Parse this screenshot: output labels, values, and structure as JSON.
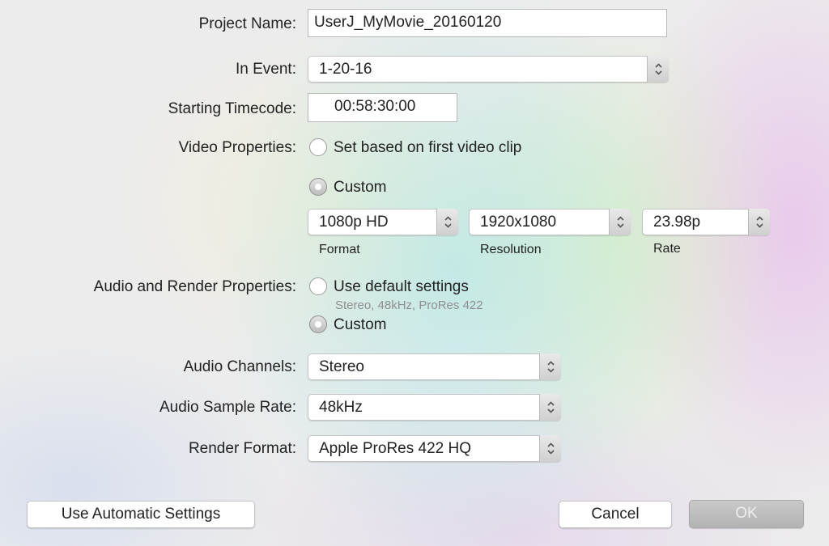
{
  "project_name": {
    "label": "Project Name:",
    "value": "UserJ_MyMovie_20160120"
  },
  "in_event": {
    "label": "In Event:",
    "value": "1-20-16"
  },
  "starting_timecode": {
    "label": "Starting Timecode:",
    "value": "00:58:30:00"
  },
  "video_properties": {
    "label": "Video Properties:",
    "option_first_clip": "Set based on first video clip",
    "option_custom": "Custom",
    "selected": "custom",
    "format": {
      "value": "1080p HD",
      "caption": "Format"
    },
    "resolution": {
      "value": "1920x1080",
      "caption": "Resolution"
    },
    "rate": {
      "value": "23.98p",
      "caption": "Rate"
    }
  },
  "audio_render_properties": {
    "label": "Audio and Render Properties:",
    "option_default": "Use default settings",
    "default_hint": "Stereo, 48kHz, ProRes 422",
    "option_custom": "Custom",
    "selected": "custom"
  },
  "audio_channels": {
    "label": "Audio Channels:",
    "value": "Stereo"
  },
  "audio_sample_rate": {
    "label": "Audio Sample Rate:",
    "value": "48kHz"
  },
  "render_format": {
    "label": "Render Format:",
    "value": "Apple ProRes 422 HQ"
  },
  "buttons": {
    "automatic": "Use Automatic Settings",
    "cancel": "Cancel",
    "ok": "OK"
  },
  "icons": {
    "popup_arrows": "up-down-chevron-icon"
  }
}
